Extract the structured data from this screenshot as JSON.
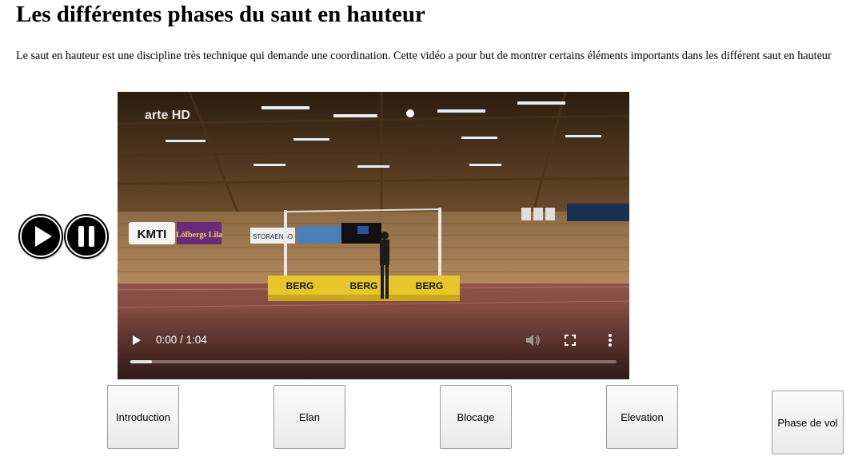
{
  "page": {
    "title": "Les différentes phases du saut en hauteur",
    "description": "Le saut en hauteur est une discipline très technique qui demande une coordination. Cette vidéo a pour but de montrer certains éléments importants dans les différent saut en hauteur"
  },
  "media_buttons": {
    "play_icon": "play-icon",
    "pause_icon": "pause-icon"
  },
  "video": {
    "current_time": "0:00",
    "duration": "1:04",
    "time_display": "0:00 / 1:04",
    "progress": 0.045,
    "watermark": "arte HD",
    "scene_signs": [
      "KMTI",
      "Löfbergs Lila",
      "STORAENSO",
      "BERG",
      "BERG",
      "BERG"
    ]
  },
  "phases": [
    {
      "label": "Introduction"
    },
    {
      "label": "Elan"
    },
    {
      "label": "Blocage"
    },
    {
      "label": "Elevation"
    },
    {
      "label": "Phase de vol"
    }
  ]
}
